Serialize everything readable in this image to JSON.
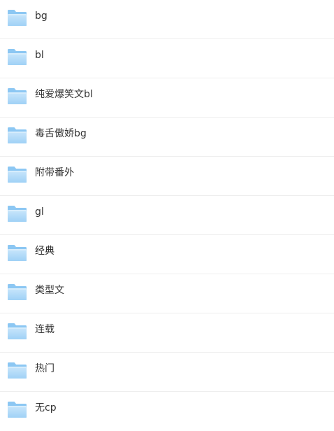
{
  "folders": [
    {
      "label": "bg"
    },
    {
      "label": "bl"
    },
    {
      "label": "纯爱爆笑文bl"
    },
    {
      "label": "毒舌傲娇bg"
    },
    {
      "label": "附带番外"
    },
    {
      "label": "gl"
    },
    {
      "label": "经典"
    },
    {
      "label": "类型文"
    },
    {
      "label": "连载"
    },
    {
      "label": "热门"
    },
    {
      "label": "无cp"
    }
  ],
  "icon": "folder-icon",
  "colors": {
    "folder_back": "#8cc7f3",
    "folder_front_top": "#c9e6fb",
    "folder_front_bottom": "#9fd1f6",
    "text": "#333333",
    "divider": "#eeeeee"
  }
}
